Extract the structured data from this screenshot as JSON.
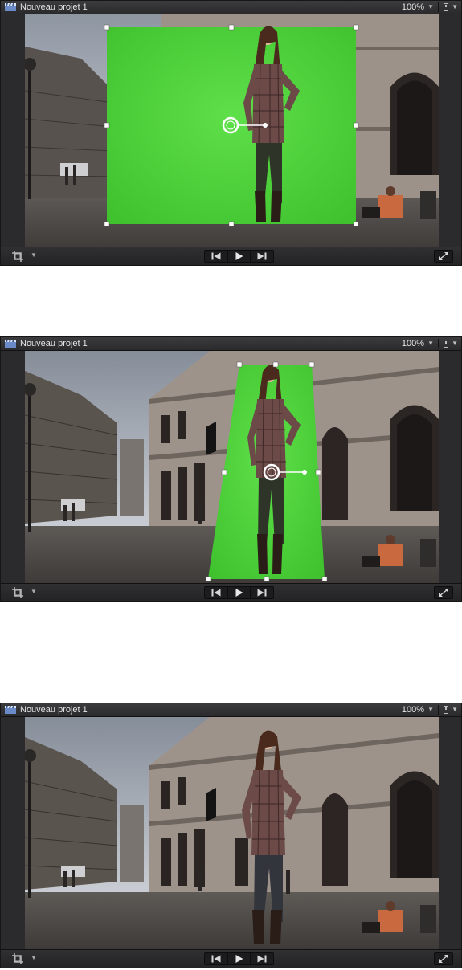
{
  "colors": {
    "keyGreen": "#4fd43a",
    "viewerBackground": "#2b2b2d",
    "handleWhite": "#ffffff"
  },
  "viewers": [
    {
      "title": "Nouveau projet 1",
      "zoom": "100%",
      "state": "green-screen-scaled-in-front-of-background",
      "onscreen_controls": "transform-handles",
      "icons": [
        "clapperboard-icon",
        "view-options-icon",
        "crop-tool-icon",
        "go-to-start-icon",
        "play-icon",
        "go-to-end-icon",
        "fullscreen-icon"
      ]
    },
    {
      "title": "Nouveau projet 1",
      "zoom": "100%",
      "state": "green-screen-distorted-in-perspective",
      "onscreen_controls": "distort-handles",
      "icons": [
        "clapperboard-icon",
        "view-options-icon",
        "crop-tool-icon",
        "go-to-start-icon",
        "play-icon",
        "go-to-end-icon",
        "fullscreen-icon"
      ]
    },
    {
      "title": "Nouveau projet 1",
      "zoom": "100%",
      "state": "keyed-subject-composited",
      "onscreen_controls": "none",
      "icons": [
        "clapperboard-icon",
        "view-options-icon",
        "crop-tool-icon",
        "go-to-start-icon",
        "play-icon",
        "go-to-end-icon",
        "fullscreen-icon"
      ]
    }
  ]
}
